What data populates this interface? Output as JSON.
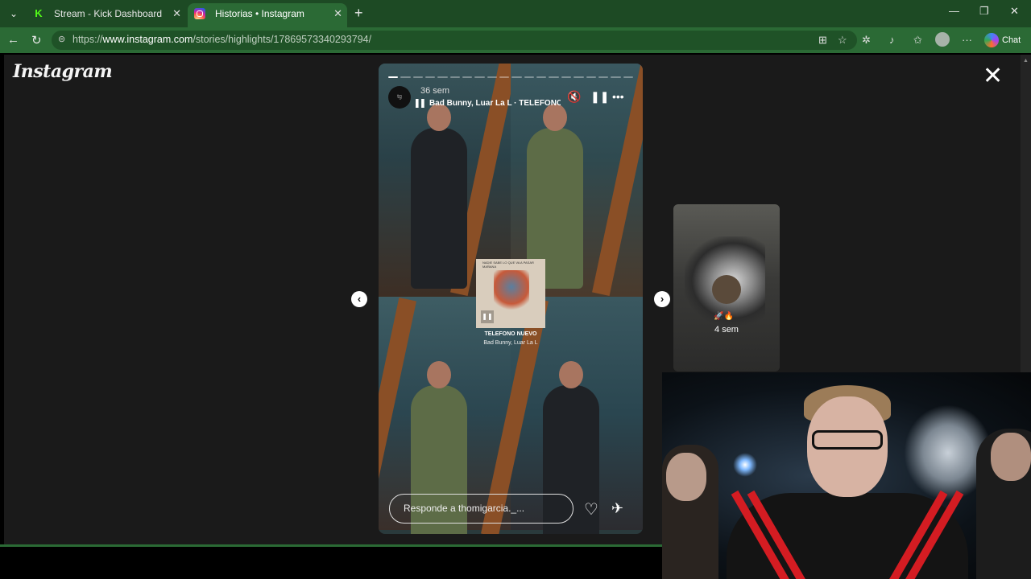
{
  "browser": {
    "tabs": [
      {
        "title": "Stream - Kick Dashboard",
        "active": false,
        "favicon": "kick-logo"
      },
      {
        "title": "Historias • Instagram",
        "active": true,
        "favicon": "instagram-logo"
      }
    ],
    "url": {
      "prefix": "https://",
      "host": "www.instagram.com",
      "path": "/stories/highlights/17869573340293794/"
    },
    "chat_label": "Chat",
    "accent": "#2b6a35"
  },
  "instagram": {
    "logo_text": "Instagram",
    "story": {
      "time_ago": "36 sem",
      "song": "Bad Bunny, Luar La L · TELEFONO NU",
      "music_card_title": "TELEFONO NUEVO",
      "music_card_artist": "Bad Bunny, Luar La L",
      "music_card_caption": "NADIE SABE LO QUE VA A PASAR MAÑANA",
      "reply_placeholder": "Responde a thomigarcia._...",
      "segments_total": 20,
      "segment_current": 1
    },
    "next_preview": {
      "time_ago": "4 sem",
      "emoji": "🚀🔥"
    }
  }
}
